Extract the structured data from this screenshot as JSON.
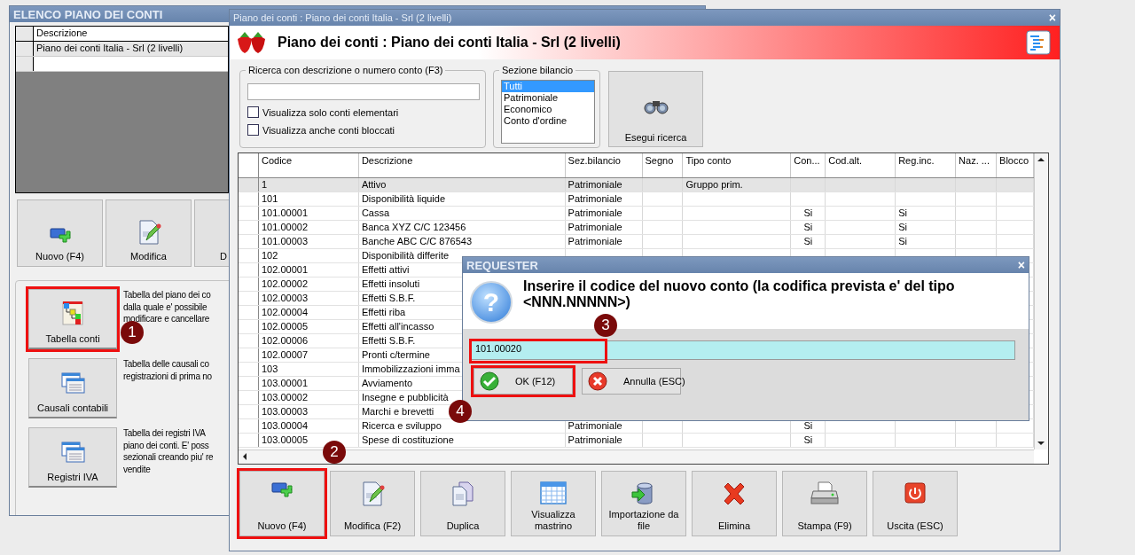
{
  "left_window": {
    "title": "ELENCO PIANO DEI CONTI",
    "grid": {
      "column": "Descrizione",
      "rows": [
        {
          "text": "Piano dei conti Italia - Srl (2 livelli)",
          "selected": true
        }
      ]
    },
    "buttons": [
      {
        "label": "Nuovo (F4)",
        "kind": "new"
      },
      {
        "label": "Modifica",
        "kind": "edit"
      },
      {
        "label": "D",
        "kind": "partial"
      }
    ],
    "tools": [
      {
        "label": "Tabella conti",
        "kind": "tree",
        "highlighted": true,
        "callout": "1",
        "description": [
          "Tabella del piano dei co",
          "dalla quale e' possibile",
          "modificare e cancellare"
        ]
      },
      {
        "label": "Causali contabili",
        "kind": "windows",
        "highlighted": false,
        "description": [
          "Tabella delle causali co",
          "registrazioni di prima no"
        ]
      },
      {
        "label": "Registri IVA",
        "kind": "windows",
        "highlighted": false,
        "description": [
          "Tabella dei registri IVA",
          "piano dei conti. E' poss",
          "sezionali creando piu' re",
          "vendite"
        ]
      }
    ]
  },
  "main_window": {
    "title": "Piano dei conti : Piano dei conti Italia - Srl (2 livelli)",
    "close": "×",
    "header": {
      "title": "Piano dei conti : Piano dei conti Italia - Srl (2 livelli)"
    },
    "search": {
      "label": "Ricerca con descrizione o numero conto (F3)",
      "checkboxes": [
        {
          "label": "Visualizza solo conti elementari",
          "checked": false
        },
        {
          "label": "Visualizza anche conti bloccati",
          "checked": false
        }
      ]
    },
    "section": {
      "label": "Sezione bilancio",
      "options": [
        {
          "label": "Tutti",
          "selected": true
        },
        {
          "label": "Patrimoniale",
          "selected": false
        },
        {
          "label": "Economico",
          "selected": false
        },
        {
          "label": "Conto d'ordine",
          "selected": false
        }
      ]
    },
    "search_button": {
      "label": "Esegui ricerca"
    },
    "table": {
      "columns": [
        "Codice",
        "Descrizione",
        "Sez.bilancio",
        "Segno",
        "Tipo conto",
        "Con...",
        "Cod.alt.",
        "Reg.inc.",
        "Naz. ...",
        "Blocco"
      ],
      "rows": [
        {
          "codice": "1",
          "descrizione": "Attivo",
          "sez_bilancio": "Patrimoniale",
          "tipo_conto": "Gruppo prim.",
          "selected": true
        },
        {
          "codice": "101",
          "descrizione": "Disponibilità liquide",
          "sez_bilancio": "Patrimoniale",
          "selected": false
        },
        {
          "codice": "101.00001",
          "descrizione": "Cassa",
          "sez_bilancio": "Patrimoniale",
          "con": "Si",
          "reg_inc": "Si",
          "selected": false
        },
        {
          "codice": "101.00002",
          "descrizione": "Banca XYZ C/C 123456",
          "sez_bilancio": "Patrimoniale",
          "con": "Si",
          "reg_inc": "Si",
          "selected": false
        },
        {
          "codice": "101.00003",
          "descrizione": "Banche ABC C/C 876543",
          "sez_bilancio": "Patrimoniale",
          "con": "Si",
          "reg_inc": "Si",
          "selected": false
        },
        {
          "codice": "102",
          "descrizione": "Disponibilità differite",
          "selected": false
        },
        {
          "codice": "102.00001",
          "descrizione": "Effetti attivi",
          "selected": false
        },
        {
          "codice": "102.00002",
          "descrizione": "Effetti insoluti",
          "selected": false
        },
        {
          "codice": "102.00003",
          "descrizione": "Effetti S.B.F.",
          "selected": false
        },
        {
          "codice": "102.00004",
          "descrizione": "Effetti riba",
          "selected": false
        },
        {
          "codice": "102.00005",
          "descrizione": "Effetti all'incasso",
          "selected": false
        },
        {
          "codice": "102.00006",
          "descrizione": "Effetti S.B.F.",
          "selected": false
        },
        {
          "codice": "102.00007",
          "descrizione": "Pronti c/termine",
          "selected": false
        },
        {
          "codice": "103",
          "descrizione": "Immobilizzazioni imma",
          "selected": false
        },
        {
          "codice": "103.00001",
          "descrizione": "Avviamento",
          "selected": false
        },
        {
          "codice": "103.00002",
          "descrizione": "Insegne e pubblicità",
          "selected": false
        },
        {
          "codice": "103.00003",
          "descrizione": "Marchi e brevetti",
          "selected": false
        },
        {
          "codice": "103.00004",
          "descrizione": "Ricerca e sviluppo",
          "sez_bilancio": "Patrimoniale",
          "con": "Si",
          "selected": false
        },
        {
          "codice": "103.00005",
          "descrizione": "Spese di costituzione",
          "sez_bilancio": "Patrimoniale",
          "con": "Si",
          "selected": false
        }
      ]
    },
    "toolbar": [
      {
        "label": "Nuovo (F4)",
        "kind": "new",
        "highlighted": true,
        "callout": "2"
      },
      {
        "label": "Modifica (F2)",
        "kind": "edit",
        "highlighted": false
      },
      {
        "label": "Duplica",
        "kind": "duplicate",
        "highlighted": false
      },
      {
        "label": "Visualizza mastrino",
        "kind": "calendar",
        "highlighted": false
      },
      {
        "label": "Importazione da file",
        "kind": "database",
        "highlighted": false
      },
      {
        "label": "Elimina",
        "kind": "delete",
        "highlighted": false
      },
      {
        "label": "Stampa (F9)",
        "kind": "printer",
        "highlighted": false
      },
      {
        "label": "Uscita (ESC)",
        "kind": "exit",
        "highlighted": false
      }
    ]
  },
  "dialog": {
    "title": "REQUESTER",
    "close": "×",
    "icon_glyph": "?",
    "message": "Inserire il codice del nuovo conto (la codifica prevista e' del tipo <NNN.NNNNN>)",
    "input": {
      "value": "101.00020",
      "highlighted": true,
      "callout": "3"
    },
    "buttons": [
      {
        "label": "OK (F12)",
        "kind": "ok",
        "highlighted": true,
        "callout": "4"
      },
      {
        "label": "Annulla (ESC)",
        "kind": "cancel",
        "highlighted": false
      }
    ]
  }
}
